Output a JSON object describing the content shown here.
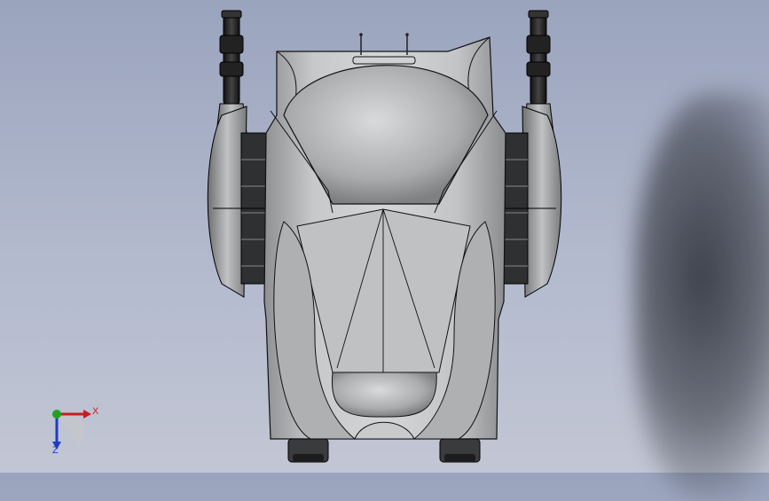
{
  "viewport": {
    "background_top": "#9aa4bd",
    "background_bottom": "#c2c6d4"
  },
  "model": {
    "body_color": "#b9bbbd",
    "edge_color": "#1a1a1a",
    "barrel_color": "#2a2a2a"
  },
  "triad": {
    "x_label": "X",
    "z_label": "Z",
    "x_color": "#c81e1e",
    "y_color": "#1fa31f",
    "z_color": "#1e3cc8"
  }
}
